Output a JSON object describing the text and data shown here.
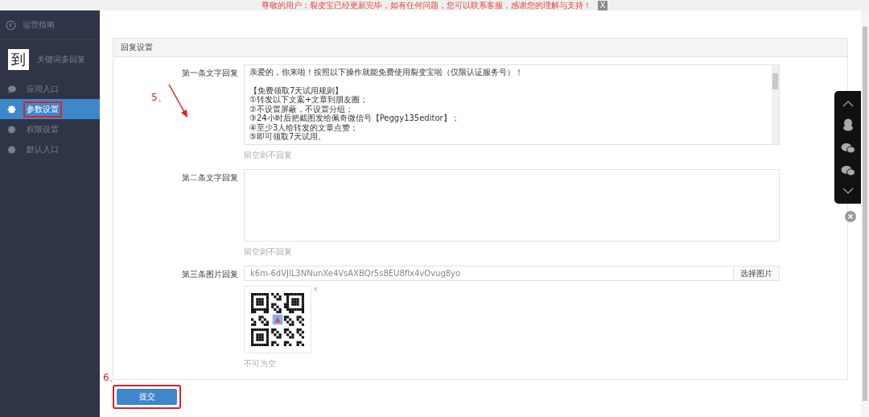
{
  "notice": {
    "text": "尊敬的用户：裂变宝已经更新完毕，如有任何问题，您可以联系客服，感谢您的理解与支持！",
    "close": "X"
  },
  "sidebar": {
    "back": "运营指南",
    "logo": {
      "mark": "到",
      "title": "关键词多回复"
    },
    "items": [
      {
        "label": "应用入口",
        "kind": "chat",
        "selected": false,
        "highlighted": false
      },
      {
        "label": "参数设置",
        "kind": "gear",
        "selected": true,
        "highlighted": true
      },
      {
        "label": "权限设置",
        "kind": "gear",
        "selected": false,
        "highlighted": false
      },
      {
        "label": "默认入口",
        "kind": "gear",
        "selected": false,
        "highlighted": false
      }
    ]
  },
  "panel": {
    "title": "回复设置",
    "fields": [
      {
        "kind": "textarea",
        "label": "第一条文字回复",
        "paragraphs": [
          [
            "亲爱的，你来啦！按照以下操作就能免费使用裂变宝啦（仅限认证服务号）！"
          ],
          [
            "【免费领取7天试用规则】",
            "①转发以下文案+文章到朋友圈；",
            "②不设置屏蔽，不设置分组；",
            "③24小时后把截图发给佩奇微信号【Peggy135editor】；",
            "④至少3人给转发的文章点赞；",
            "⑤即可领取7天试用。"
          ]
        ],
        "hint": "留空则不回复"
      },
      {
        "kind": "textarea",
        "label": "第二条文字回复",
        "hint": "留空则不回复"
      },
      {
        "kind": "image",
        "label": "第三条图片回复",
        "value": "k6m-6dVJlL3NNunXe4VsAXBQr5s8EU8flx4vOvug8yo",
        "button": "选择图片",
        "remove": "×",
        "hint": "不可为空"
      }
    ]
  },
  "submit": {
    "label": "提交",
    "highlighted": true
  },
  "annotations": [
    {
      "label": "5、",
      "kind": "arrow"
    },
    {
      "label": "6、",
      "kind": "plain"
    }
  ]
}
